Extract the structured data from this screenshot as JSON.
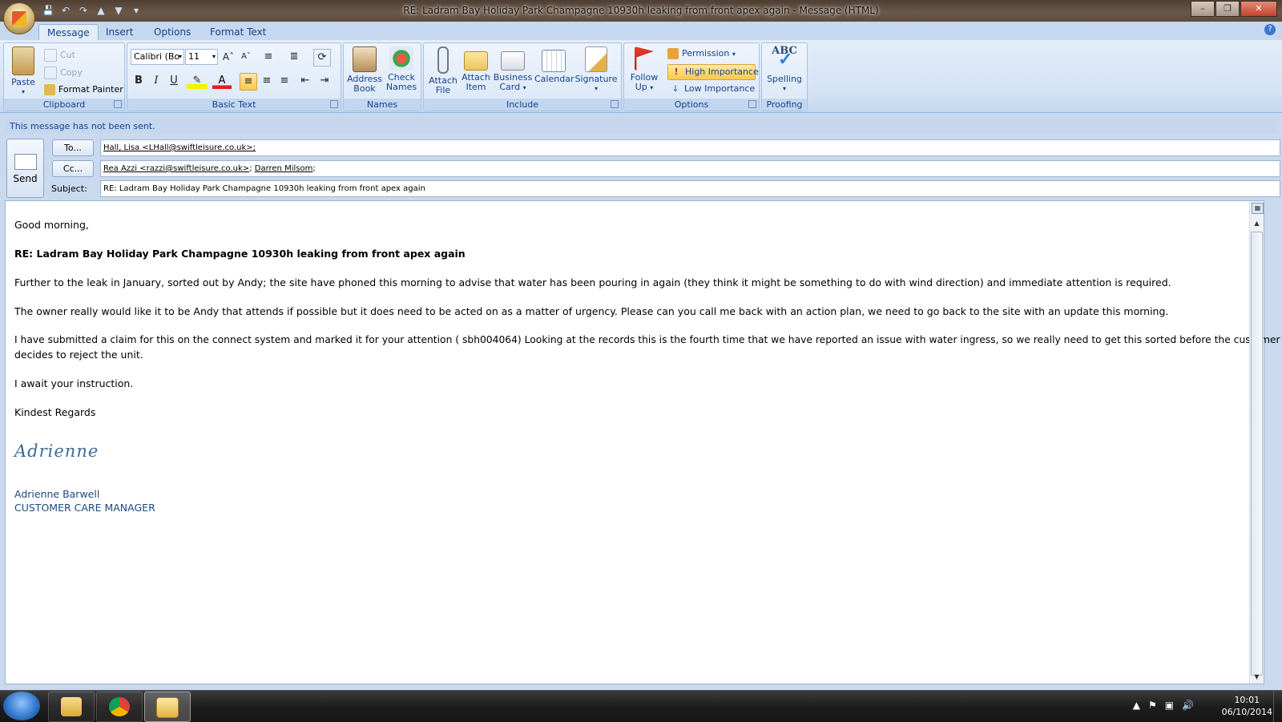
{
  "window": {
    "title": "RE: Ladram Bay Holiday Park Champagne 10930h leaking from front apex again - Message (HTML)",
    "controls": [
      "minimize",
      "restore",
      "close"
    ]
  },
  "quick_access": [
    "save-icon",
    "undo-icon",
    "redo-icon",
    "up-icon",
    "down-icon",
    "customize-icon"
  ],
  "tabs": [
    {
      "label": "Message",
      "active": true
    },
    {
      "label": "Insert",
      "active": false
    },
    {
      "label": "Options",
      "active": false
    },
    {
      "label": "Format Text",
      "active": false
    }
  ],
  "ribbon": {
    "clipboard": {
      "label": "Clipboard",
      "paste": "Paste",
      "cut": "Cut",
      "copy": "Copy",
      "format_painter": "Format Painter"
    },
    "basic_text": {
      "label": "Basic Text",
      "font": "Calibri (Bo",
      "size": "11",
      "bold": "B",
      "italic": "I",
      "underline": "U"
    },
    "names": {
      "label": "Names",
      "address_book": [
        "Address",
        "Book"
      ],
      "check_names": [
        "Check",
        "Names"
      ]
    },
    "include": {
      "label": "Include",
      "attach_file": [
        "Attach",
        "File"
      ],
      "attach_item": [
        "Attach",
        "Item"
      ],
      "business_card": [
        "Business",
        "Card"
      ],
      "calendar": "Calendar",
      "signature": "Signature"
    },
    "options": {
      "label": "Options",
      "follow_up": [
        "Follow",
        "Up"
      ],
      "permission": "Permission",
      "high_importance": "High Importance",
      "low_importance": "Low Importance"
    },
    "proofing": {
      "label": "Proofing",
      "spelling_icon_text": "ABC",
      "spelling": "Spelling"
    }
  },
  "info_bar": "This message has not been sent.",
  "header": {
    "send": "Send",
    "to_button": "To...",
    "cc_button": "Cc...",
    "subject_label": "Subject:",
    "to": "Hall, Lisa <LHall@swiftleisure.co.uk>;",
    "cc": [
      "Rea Azzi <razzi@swiftleisure.co.uk>",
      "Darren Milsom"
    ],
    "subject": "RE: Ladram Bay Holiday Park Champagne 10930h leaking from front apex again"
  },
  "body": {
    "greeting": "Good morning,",
    "heading": "RE: Ladram Bay Holiday Park Champagne 10930h leaking from front apex again",
    "p1": "Further to the leak in January, sorted out by Andy; the site have phoned this morning to advise that water has been pouring in again  (they think it might be something to do with wind direction)  and immediate  attention is required.",
    "p2": "The owner really would like it to be Andy that attends if possible but it does need to be acted on as a matter of urgency.  Please can you call me back with an action plan, we need to go back to the site with an update this morning.",
    "p3a": "I have submitted a claim for this on the connect system and marked it for your attention ( sbh004064)  Looking at the records this is the fourth time that we have reported an issue with water ingress, so we really need to get this sorted before the customer",
    "p3b": "decides to reject the unit.",
    "p4": "I await your instruction.",
    "closing": "Kindest Regards",
    "signature_script": "Adrienne",
    "sig_name": "Adrienne Barwell",
    "sig_title": "CUSTOMER CARE MANAGER"
  },
  "taskbar": {
    "apps": [
      "windows-explorer",
      "google-chrome",
      "outlook"
    ],
    "time": "10:01",
    "date": "06/10/2014"
  },
  "colors": {
    "ribbon_label": "#15428b",
    "high_importance": "#fbc94d",
    "signature": "#3c6a9a"
  }
}
